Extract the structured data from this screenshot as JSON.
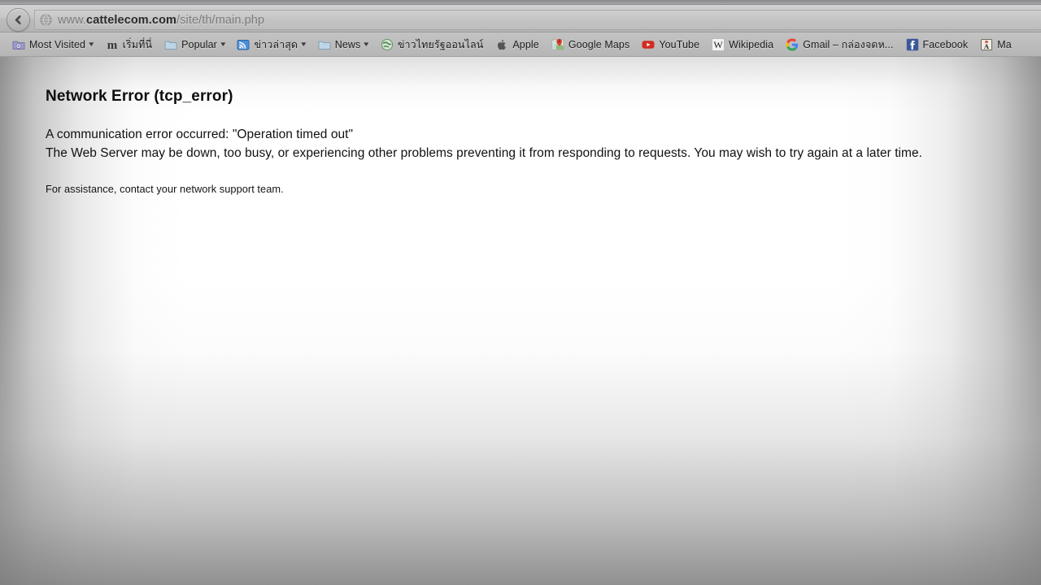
{
  "browser": {
    "back_button": "Back",
    "back_icon": "arrow-left-icon",
    "url": {
      "icon": "globe-icon",
      "prefix": "www.",
      "host": "cattelecom.com",
      "path": "/site/th/main.php",
      "full": "www.cattelecom.com/site/th/main.php"
    },
    "bookmarks": [
      {
        "label": "Most Visited",
        "icon": "most-visited-folder-icon",
        "has_caret": true
      },
      {
        "label": "เริ่มที่นี่",
        "icon": "mozilla-m-icon",
        "has_caret": false
      },
      {
        "label": "Popular",
        "icon": "folder-icon",
        "has_caret": true
      },
      {
        "label": "ข่าวล่าสุด",
        "icon": "rss-feed-icon",
        "has_caret": true
      },
      {
        "label": "News",
        "icon": "folder-icon",
        "has_caret": true
      },
      {
        "label": "ข่าวไทยรัฐออนไลน์",
        "icon": "thairath-globe-icon",
        "has_caret": false
      },
      {
        "label": "Apple",
        "icon": "apple-logo-icon",
        "has_caret": false
      },
      {
        "label": "Google Maps",
        "icon": "google-maps-pin-icon",
        "has_caret": false
      },
      {
        "label": "YouTube",
        "icon": "youtube-play-icon",
        "has_caret": false
      },
      {
        "label": "Wikipedia",
        "icon": "wikipedia-w-icon",
        "has_caret": false
      },
      {
        "label": "Gmail – กล่องจดห...",
        "icon": "google-g-icon",
        "has_caret": false
      },
      {
        "label": "Facebook",
        "icon": "facebook-f-icon",
        "has_caret": false
      },
      {
        "label": "Ma",
        "icon": "dictionary-a-icon",
        "has_caret": false
      }
    ]
  },
  "page": {
    "title": "Network Error (tcp_error)",
    "message_line1": "A communication error occurred: \"Operation timed out\"",
    "message_line2": "The Web Server may be down, too busy, or experiencing other problems preventing it from responding to requests. You may wish to try again at a later time.",
    "assistance": "For assistance, contact your network support team."
  },
  "colors": {
    "chrome_bg": "#bdbdbd",
    "page_bg": "#ffffff",
    "text": "#111111",
    "url_host": "#2a2a2a",
    "url_dim": "#7a7a7a"
  }
}
